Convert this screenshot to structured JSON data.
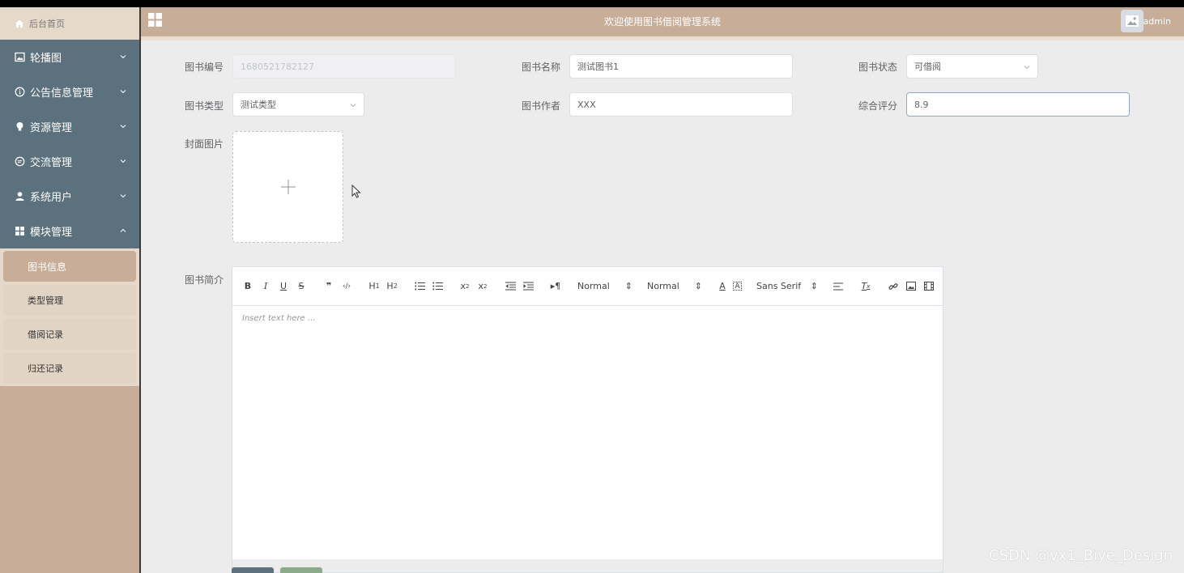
{
  "sidebar": {
    "home_label": "后台首页",
    "menu": [
      {
        "label": "轮播图",
        "icon": "picture-icon"
      },
      {
        "label": "公告信息管理",
        "icon": "info-icon"
      },
      {
        "label": "资源管理",
        "icon": "bulb-icon"
      },
      {
        "label": "交流管理",
        "icon": "chat-icon"
      },
      {
        "label": "系统用户",
        "icon": "user-icon"
      },
      {
        "label": "模块管理",
        "icon": "grid-icon"
      }
    ],
    "submenu": [
      "图书信息",
      "类型管理",
      "借阅记录",
      "归还记录"
    ],
    "active_submenu": "图书信息"
  },
  "header": {
    "title": "欢迎使用图书借阅管理系统",
    "user": "admin"
  },
  "form": {
    "book_no": {
      "label": "图书编号",
      "value": "1680521782127"
    },
    "book_name": {
      "label": "图书名称",
      "value": "测试图书1"
    },
    "book_status": {
      "label": "图书状态",
      "value": "可借阅"
    },
    "book_type": {
      "label": "图书类型",
      "value": "测试类型"
    },
    "book_author": {
      "label": "图书作者",
      "value": "XXX"
    },
    "rating": {
      "label": "综合评分",
      "value": "8.9"
    },
    "cover": {
      "label": "封面图片"
    },
    "intro": {
      "label": "图书简介",
      "placeholder": "Insert text here ..."
    }
  },
  "editor_toolbar": {
    "header_select": "Normal",
    "size_select": "Normal",
    "font_select": "Sans Serif"
  },
  "watermark": "CSDN @vx1_Biye_Design",
  "colors": {
    "sidebar_bg": "#c8ad98",
    "menu_bg": "#5b717d",
    "submenu_bg": "#e6d9c9",
    "main_bg": "#ececec"
  }
}
